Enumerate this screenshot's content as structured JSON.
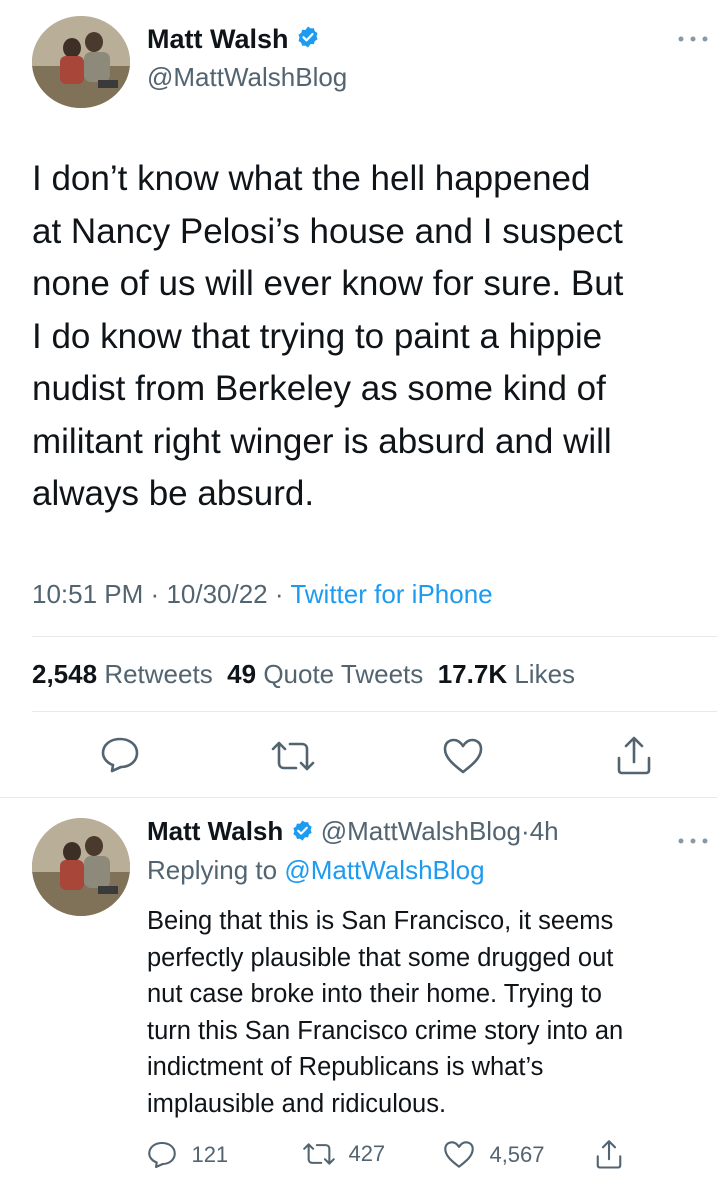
{
  "main_tweet": {
    "author_name": "Matt Walsh",
    "author_handle": "@MattWalshBlog",
    "more_icon": "more-dots-icon",
    "text": "I don’t know what the hell happened at Nancy Pelosi’s house and I suspect none of us will ever know for sure. But I do know that trying to paint a hippie nudist from Berkeley as some kind of militant right winger is absurd and will always be absurd.",
    "lines": [
      "I don’t know what the hell happened",
      "at Nancy Pelosi’s house and I suspect",
      "none of us will ever know for sure. But",
      "I do know that trying to paint a hippie",
      "nudist from Berkeley as some kind of",
      "militant right winger is absurd and will",
      "always be absurd."
    ],
    "time": "10:51 PM",
    "date": "10/30/22",
    "separator": "·",
    "source": "Twitter for iPhone",
    "stats": {
      "retweets_count": "2,548",
      "retweets_label": "Retweets",
      "quotes_count": "49",
      "quotes_label": "Quote Tweets",
      "likes_count": "17.7K",
      "likes_label": "Likes"
    },
    "actions": [
      "reply-icon",
      "retweet-icon",
      "like-icon",
      "share-icon"
    ]
  },
  "reply_tweet": {
    "author_name": "Matt Walsh",
    "author_handle": "@MattWalshBlog",
    "separator": "·",
    "age": "4h",
    "replying_label": "Replying to",
    "replying_handle": "@MattWalshBlog",
    "lines": [
      "Being that this is San Francisco, it seems",
      "perfectly plausible that some drugged out",
      "nut case broke into their home. Trying to",
      "turn this San Francisco crime story into an",
      "indictment of Republicans is what’s",
      "implausible and ridiculous."
    ],
    "counts": {
      "replies": "121",
      "retweets": "427",
      "likes": "4,567"
    }
  },
  "colors": {
    "accent": "#1d9bf0",
    "muted": "#536471",
    "text": "#0f1419",
    "divider": "#e7e9ea"
  }
}
